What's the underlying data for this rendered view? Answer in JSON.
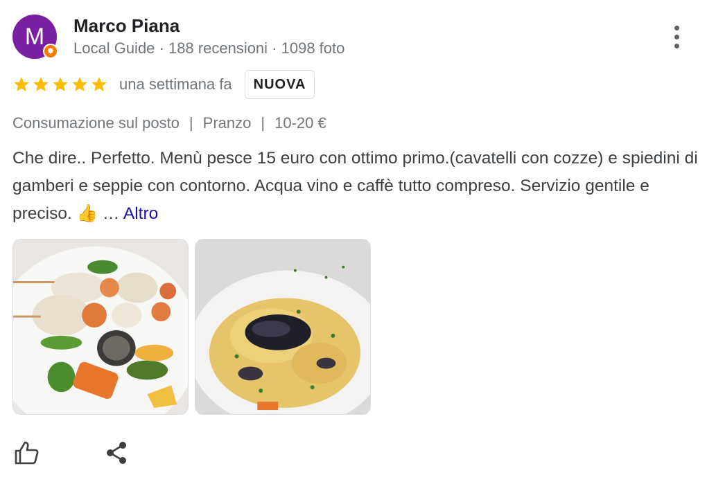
{
  "author": {
    "avatar_letter": "M",
    "avatar_color": "#7b1fa2",
    "badge_icon": "local-guide-star-icon",
    "name": "Marco Piana",
    "meta": "Local Guide · 188 recensioni · 1098 foto"
  },
  "rating": {
    "stars": 5,
    "star_color": "#fbbc04",
    "date": "una settimana fa",
    "badge": "NUOVA"
  },
  "attributes": {
    "service": "Consumazione sul posto",
    "separator": "|",
    "meal": "Pranzo",
    "price": "10-20 €"
  },
  "review": {
    "text": "Che dire.. Perfetto. Menù pesce 15 euro con ottimo primo.(cavatelli con cozze) e spiedini di gamberi e seppie con contorno. Acqua vino e caffè tutto compreso. Servizio gentile e preciso. 👍 …",
    "more_label": "Altro",
    "link_color": "#1a0dab"
  },
  "photos": [
    {
      "subject": "grilled-skewers-photo"
    },
    {
      "subject": "cavatelli-with-mussels-photo"
    }
  ],
  "actions": {
    "like_icon": "thumbs-up-icon",
    "share_icon": "share-icon"
  }
}
